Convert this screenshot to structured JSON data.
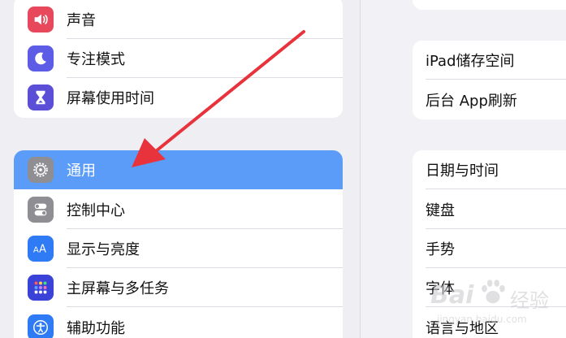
{
  "left_groups": [
    {
      "items": [
        {
          "label": "声音",
          "icon": "speaker-icon",
          "color": "#e8485c"
        },
        {
          "label": "专注模式",
          "icon": "moon-icon",
          "color": "#5d5ce6"
        },
        {
          "label": "屏幕使用时间",
          "icon": "hourglass-icon",
          "color": "#5b4fd8"
        }
      ]
    },
    {
      "items": [
        {
          "label": "通用",
          "icon": "gear-icon",
          "color": "#8e8e93",
          "selected": true
        },
        {
          "label": "控制中心",
          "icon": "toggles-icon",
          "color": "#8e8e93"
        },
        {
          "label": "显示与亮度",
          "icon": "text-size-icon",
          "color": "#2f7bf6"
        },
        {
          "label": "主屏幕与多任务",
          "icon": "app-grid-icon",
          "color": "#3a42d8"
        },
        {
          "label": "辅助功能",
          "icon": "accessibility-icon",
          "color": "#2f7bf6"
        }
      ]
    }
  ],
  "right_groups": [
    {
      "items": [
        {
          "label": "iPad储存空间"
        },
        {
          "label": "后台 App刷新"
        }
      ]
    },
    {
      "items": [
        {
          "label": "日期与时间"
        },
        {
          "label": "键盘"
        },
        {
          "label": "手势"
        },
        {
          "label": "字体"
        },
        {
          "label": "语言与地区"
        }
      ]
    }
  ],
  "watermark": {
    "brand": "Bai",
    "brand2": "经验",
    "url": "jingyan.baidu.com"
  },
  "colors": {
    "selected": "#5b9cf8",
    "arrow": "#e8323c"
  }
}
